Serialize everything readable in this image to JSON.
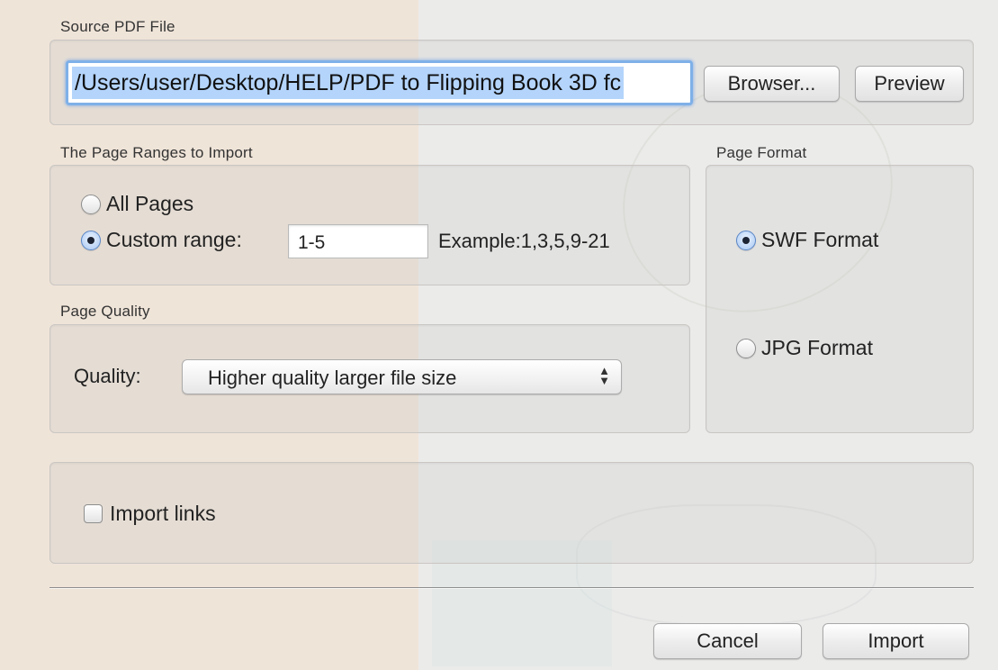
{
  "source": {
    "group_label": "Source PDF File",
    "path_value": "/Users/user/Desktop/HELP/PDF to Flipping Book 3D fc",
    "browse_label": "Browser...",
    "preview_label": "Preview"
  },
  "page_ranges": {
    "group_label": "The Page Ranges to Import",
    "all_pages_label": "All Pages",
    "all_pages_selected": false,
    "custom_range_label": "Custom range:",
    "custom_range_selected": true,
    "custom_range_value": "1-5",
    "example_text": "Example:1,3,5,9-21"
  },
  "page_format": {
    "group_label": "Page Format",
    "swf_label": "SWF Format",
    "swf_selected": true,
    "jpg_label": "JPG Format",
    "jpg_selected": false
  },
  "page_quality": {
    "group_label": "Page Quality",
    "quality_label": "Quality:",
    "selected_option": "Higher quality larger file size"
  },
  "options": {
    "import_links_label": "Import links",
    "import_links_checked": false
  },
  "footer": {
    "cancel_label": "Cancel",
    "import_label": "Import"
  },
  "colors": {
    "focus_ring": "#7fb0e8",
    "selection": "#b4d4fb",
    "radio_selected": "#a7c7f2"
  }
}
